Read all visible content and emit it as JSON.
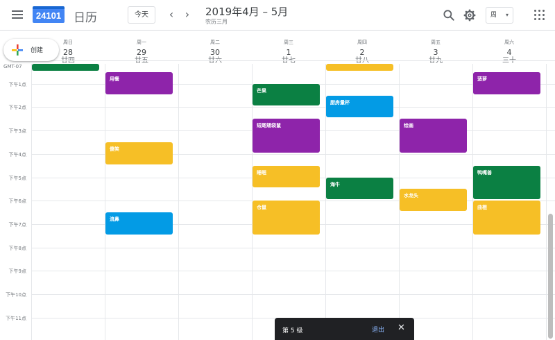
{
  "header": {
    "logo_text": "24101",
    "app_name": "日历",
    "today_label": "今天",
    "prev_icon": "‹",
    "next_icon": "›",
    "date_title": "2019年4月 – 5月",
    "lunar_subtitle": "农历三月",
    "view_label": "周",
    "view_caret": "▾"
  },
  "create_label": "创建",
  "timezone": "GMT-07",
  "days": [
    {
      "dow": "周日",
      "num": "28",
      "lunar": "廿四"
    },
    {
      "dow": "周一",
      "num": "29",
      "lunar": "廿五"
    },
    {
      "dow": "周二",
      "num": "30",
      "lunar": "廿六"
    },
    {
      "dow": "周三",
      "num": "1",
      "lunar": "廿七"
    },
    {
      "dow": "周四",
      "num": "2",
      "lunar": "廿八"
    },
    {
      "dow": "周五",
      "num": "3",
      "lunar": "廿九"
    },
    {
      "dow": "周六",
      "num": "4",
      "lunar": "三十"
    }
  ],
  "hours": [
    "下午1点",
    "下午2点",
    "下午3点",
    "下午4点",
    "下午5点",
    "下午6点",
    "下午7点",
    "下午8点",
    "下午9点",
    "下午10点",
    "下午11点"
  ],
  "colors": {
    "green": "#0b8043",
    "purple": "#8e24aa",
    "yellow": "#f6bf26",
    "blue": "#039be5"
  },
  "events": [
    {
      "day": 0,
      "start": "12:00",
      "end": "12:30",
      "title": "",
      "color": "green"
    },
    {
      "day": 1,
      "start": "12:30",
      "end": "13:30",
      "title": "用餐",
      "color": "purple"
    },
    {
      "day": 1,
      "start": "15:30",
      "end": "16:30",
      "title": "傻笑",
      "color": "yellow"
    },
    {
      "day": 1,
      "start": "18:30",
      "end": "19:30",
      "title": "流鼻",
      "color": "blue"
    },
    {
      "day": 3,
      "start": "13:00",
      "end": "14:00",
      "title": "芒果",
      "color": "green"
    },
    {
      "day": 3,
      "start": "14:30",
      "end": "16:00",
      "title": "短尾矮袋鼠",
      "color": "purple"
    },
    {
      "day": 3,
      "start": "16:30",
      "end": "17:30",
      "title": "睡眠",
      "color": "yellow"
    },
    {
      "day": 3,
      "start": "18:00",
      "end": "19:30",
      "title": "仓鼠",
      "color": "yellow"
    },
    {
      "day": 4,
      "start": "12:00",
      "end": "12:30",
      "title": "",
      "color": "yellow"
    },
    {
      "day": 4,
      "start": "13:30",
      "end": "14:30",
      "title": "厨房量杯",
      "color": "blue"
    },
    {
      "day": 4,
      "start": "17:00",
      "end": "18:00",
      "title": "海牛",
      "color": "green"
    },
    {
      "day": 5,
      "start": "14:30",
      "end": "16:00",
      "title": "绘画",
      "color": "purple"
    },
    {
      "day": 5,
      "start": "17:30",
      "end": "18:30",
      "title": "水龙头",
      "color": "yellow"
    },
    {
      "day": 6,
      "start": "12:30",
      "end": "13:30",
      "title": "菠萝",
      "color": "purple"
    },
    {
      "day": 6,
      "start": "16:30",
      "end": "18:00",
      "title": "鸭嘴兽",
      "color": "green"
    },
    {
      "day": 6,
      "start": "18:00",
      "end": "19:30",
      "title": "曲棍",
      "color": "yellow"
    }
  ],
  "snackbar": {
    "message": "第 5 级",
    "exit_label": "退出",
    "close_icon": "✕"
  }
}
